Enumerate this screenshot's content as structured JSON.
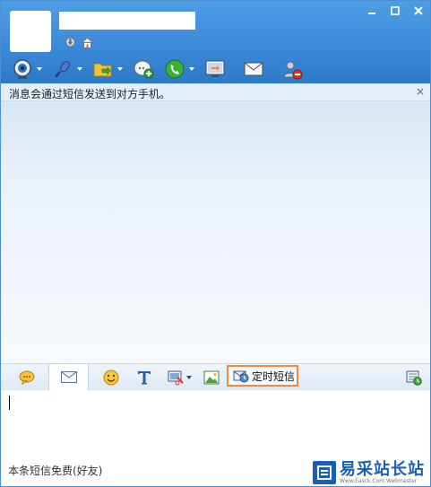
{
  "window": {
    "controls": {
      "minimize_icon": "minimize-icon",
      "maximize_icon": "maximize-icon",
      "close_icon": "close-icon"
    }
  },
  "toolbar": {
    "buttons": [
      {
        "name": "video-button",
        "icon": "webcam-icon",
        "dropdown": true
      },
      {
        "name": "voice-button",
        "icon": "microphone-icon",
        "dropdown": true
      },
      {
        "name": "file-transfer-button",
        "icon": "folder-transfer-icon",
        "dropdown": true
      },
      {
        "name": "create-group-button",
        "icon": "add-chat-icon",
        "dropdown": false
      },
      {
        "name": "phone-button",
        "icon": "phone-icon",
        "dropdown": true
      },
      {
        "name": "remote-assistance-button",
        "icon": "screen-share-icon",
        "dropdown": false
      },
      {
        "name": "send-email-button",
        "icon": "envelope-icon",
        "dropdown": false
      },
      {
        "name": "block-contact-button",
        "icon": "block-user-icon",
        "dropdown": false
      }
    ]
  },
  "notice": {
    "text": "消息会通过短信发送到对方手机。",
    "close": "×"
  },
  "input_toolbar": {
    "timed_sms_label": "定时短信"
  },
  "statusbar": {
    "text": "本条短信免费(好友)"
  },
  "watermark": {
    "title": "易采站长站",
    "subtitle": "Www.Easck.Com  Webmaster"
  },
  "colors": {
    "header": "#3b8ad8",
    "accent_border": "#f08a3c",
    "watermark": "#1b5fb5"
  }
}
